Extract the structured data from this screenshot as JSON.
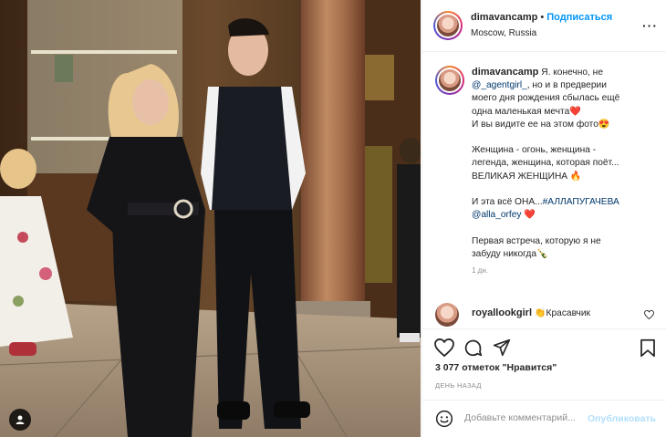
{
  "post": {
    "username": "dimavancamp",
    "follow_label": "Подписаться",
    "location": "Moscow, Russia",
    "caption": {
      "username": "dimavancamp",
      "line1": "Я. конечно, не",
      "mention1": "@_agentgirl_",
      "line2": ", но и в предверии",
      "line3": "моего дня рождения сбылась ещё",
      "line4": "одна маленькая мечта❤️",
      "line5": "И вы видите ее на этом фото😍",
      "line6": "Женщина - огонь, женщина -",
      "line7": "легенда, женщина, которая поёт...",
      "line8": "ВЕЛИКАЯ ЖЕНЩИНА 🔥",
      "line9": "И эта всё ОНА...",
      "hashtag": "#АЛЛАПУГАЧЕВА",
      "mention2": "@alla_orfey",
      "line10": "❤️",
      "line11": "Первая встреча, которую я не",
      "line12": "забуду никогда🍾",
      "time": "1 дн."
    },
    "comment": {
      "username": "royallookgirl",
      "text": "👏Красавчик"
    },
    "likes": "3 077 отметок \"Нравится\"",
    "date": "ДЕНЬ НАЗАД",
    "add_comment_placeholder": "Добавьте комментарий...",
    "publish_label": "Опубликовать",
    "icons": {
      "more": "more-options-icon",
      "like": "heart-icon",
      "comment": "comment-icon",
      "share": "share-icon",
      "save": "bookmark-icon",
      "emoji": "emoji-icon",
      "user_tag": "user-tag-icon"
    },
    "colors": {
      "link": "#00376b",
      "follow": "#0095f6",
      "publish_disabled": "#b2dffc",
      "muted": "#8e8e8e"
    }
  }
}
